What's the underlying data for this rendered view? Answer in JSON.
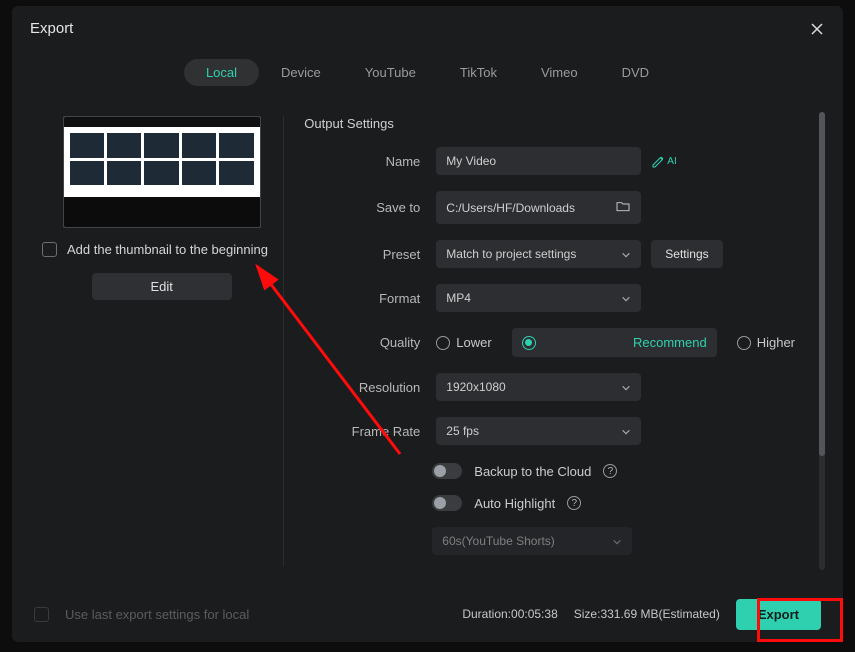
{
  "title": "Export",
  "tabs": [
    "Local",
    "Device",
    "YouTube",
    "TikTok",
    "Vimeo",
    "DVD"
  ],
  "active_tab": 0,
  "left": {
    "checkbox_label": "Add the thumbnail to the beginning",
    "edit_btn": "Edit"
  },
  "settings_heading": "Output Settings",
  "rows": {
    "name_label": "Name",
    "name_value": "My Video",
    "saveto_label": "Save to",
    "saveto_value": "C:/Users/HF/Downloads",
    "preset_label": "Preset",
    "preset_value": "Match to project settings",
    "settings_btn": "Settings",
    "format_label": "Format",
    "format_value": "MP4",
    "quality_label": "Quality",
    "quality_options": [
      "Lower",
      "Recommend",
      "Higher"
    ],
    "quality_selected": 1,
    "resolution_label": "Resolution",
    "resolution_value": "1920x1080",
    "framerate_label": "Frame Rate",
    "framerate_value": "25 fps",
    "backup_label": "Backup to the Cloud",
    "autohl_label": "Auto Highlight",
    "autohl_preset": "60s(YouTube Shorts)"
  },
  "ai_badge": "AI",
  "footer": {
    "use_last_label": "Use last export settings for local",
    "duration_label": "Duration:",
    "duration_value": "00:05:38",
    "size_label": "Size:",
    "size_value": "331.69 MB(Estimated)",
    "export_btn": "Export"
  }
}
